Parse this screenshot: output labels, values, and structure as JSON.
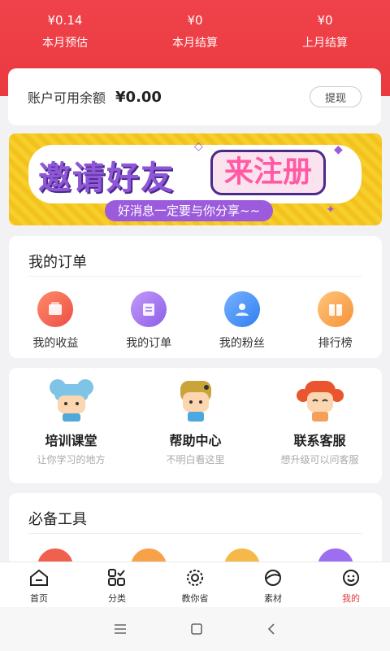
{
  "header": {
    "stats": [
      {
        "value": "¥0.14",
        "label": "本月预估"
      },
      {
        "value": "¥0",
        "label": "本月结算"
      },
      {
        "value": "¥0",
        "label": "上月结算"
      }
    ]
  },
  "balance": {
    "label": "账户可用余额",
    "amount": "¥0.00",
    "withdraw_label": "提现"
  },
  "banner": {
    "title": "邀请好友",
    "highlight": "来注册",
    "subtitle": "好消息一定要与你分享~~"
  },
  "orders": {
    "title": "我的订单",
    "items": [
      {
        "label": "我的收益",
        "icon": "income-icon",
        "color": "#f0604e"
      },
      {
        "label": "我的订单",
        "icon": "orders-icon",
        "color": "#9d6ef0"
      },
      {
        "label": "我的粉丝",
        "icon": "fans-icon",
        "color": "#3f8ef5"
      },
      {
        "label": "排行榜",
        "icon": "ranking-icon",
        "color": "#f7a249"
      }
    ]
  },
  "help": {
    "items": [
      {
        "name": "培训课堂",
        "desc": "让你学习的地方",
        "icon": "training-avatar-icon"
      },
      {
        "name": "帮助中心",
        "desc": "不明白看这里",
        "icon": "help-avatar-icon"
      },
      {
        "name": "联系客服",
        "desc": "想升级可以问客服",
        "icon": "service-avatar-icon"
      }
    ]
  },
  "tools": {
    "title": "必备工具"
  },
  "tabbar": {
    "items": [
      {
        "label": "首页",
        "icon": "home-icon"
      },
      {
        "label": "分类",
        "icon": "category-icon"
      },
      {
        "label": "教你省",
        "icon": "save-icon"
      },
      {
        "label": "素材",
        "icon": "material-icon"
      },
      {
        "label": "我的",
        "icon": "profile-icon",
        "active": true
      }
    ]
  },
  "colors": {
    "brand_red": "#ea3a40",
    "active_tab": "#e23a3a"
  }
}
